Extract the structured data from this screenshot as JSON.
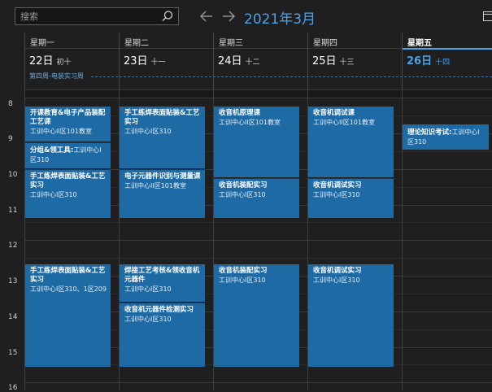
{
  "search": {
    "placeholder": "搜索"
  },
  "header": {
    "title": "2021年3月"
  },
  "days": [
    {
      "weekday": "星期一",
      "date": "22日",
      "lunar": "初十"
    },
    {
      "weekday": "星期二",
      "date": "23日",
      "lunar": "十一"
    },
    {
      "weekday": "星期三",
      "date": "24日",
      "lunar": "十二"
    },
    {
      "weekday": "星期四",
      "date": "25日",
      "lunar": "十三"
    },
    {
      "weekday": "星期五",
      "date": "26日",
      "lunar": "十四"
    }
  ],
  "allday": {
    "text": "第四周-电装实习周"
  },
  "hours": [
    "8",
    "9",
    "10",
    "11",
    "12",
    "13",
    "14",
    "15",
    "16"
  ],
  "events": {
    "mon1": {
      "title": "开课教育&电子产品装配工艺课",
      "location": "工训中心II区101教室"
    },
    "mon2": {
      "title": "分组&领工具:",
      "location": "工训中心I区310"
    },
    "mon3": {
      "title": "手工练焊表面贴装&工艺实习",
      "location": "工训中心I区310"
    },
    "mon4": {
      "title": "手工练焊表面贴装&工艺实习",
      "location": "工训中心I区310、1区209"
    },
    "tue1": {
      "title": "手工练焊表面贴装&工艺实习",
      "location": "工训中心I区310"
    },
    "tue2": {
      "title": "电子元器件识别与测量课",
      "location": "工训中心II区101教室"
    },
    "tue3": {
      "title": "焊接工艺考核&领收音机元器件",
      "location": "工训中心I区310"
    },
    "tue4": {
      "title": "收音机元器件检测实习",
      "location": "工训中心I区310"
    },
    "wed1": {
      "title": "收音机原理课",
      "location": "工训中心II区101教室"
    },
    "wed2": {
      "title": "收音机装配实习",
      "location": "工训中心I区310"
    },
    "wed3": {
      "title": "收音机装配实习",
      "location": "工训中心I区310"
    },
    "thu1": {
      "title": "收音机调试课",
      "location": "工训中心II区101教室"
    },
    "thu2": {
      "title": "收音机调试实习",
      "location": "工训中心I区310"
    },
    "thu3": {
      "title": "收音机调试实习",
      "location": "工训中心I区310"
    },
    "fri1": {
      "title": "理论知识考试:",
      "location": "工训中心I区310"
    }
  }
}
